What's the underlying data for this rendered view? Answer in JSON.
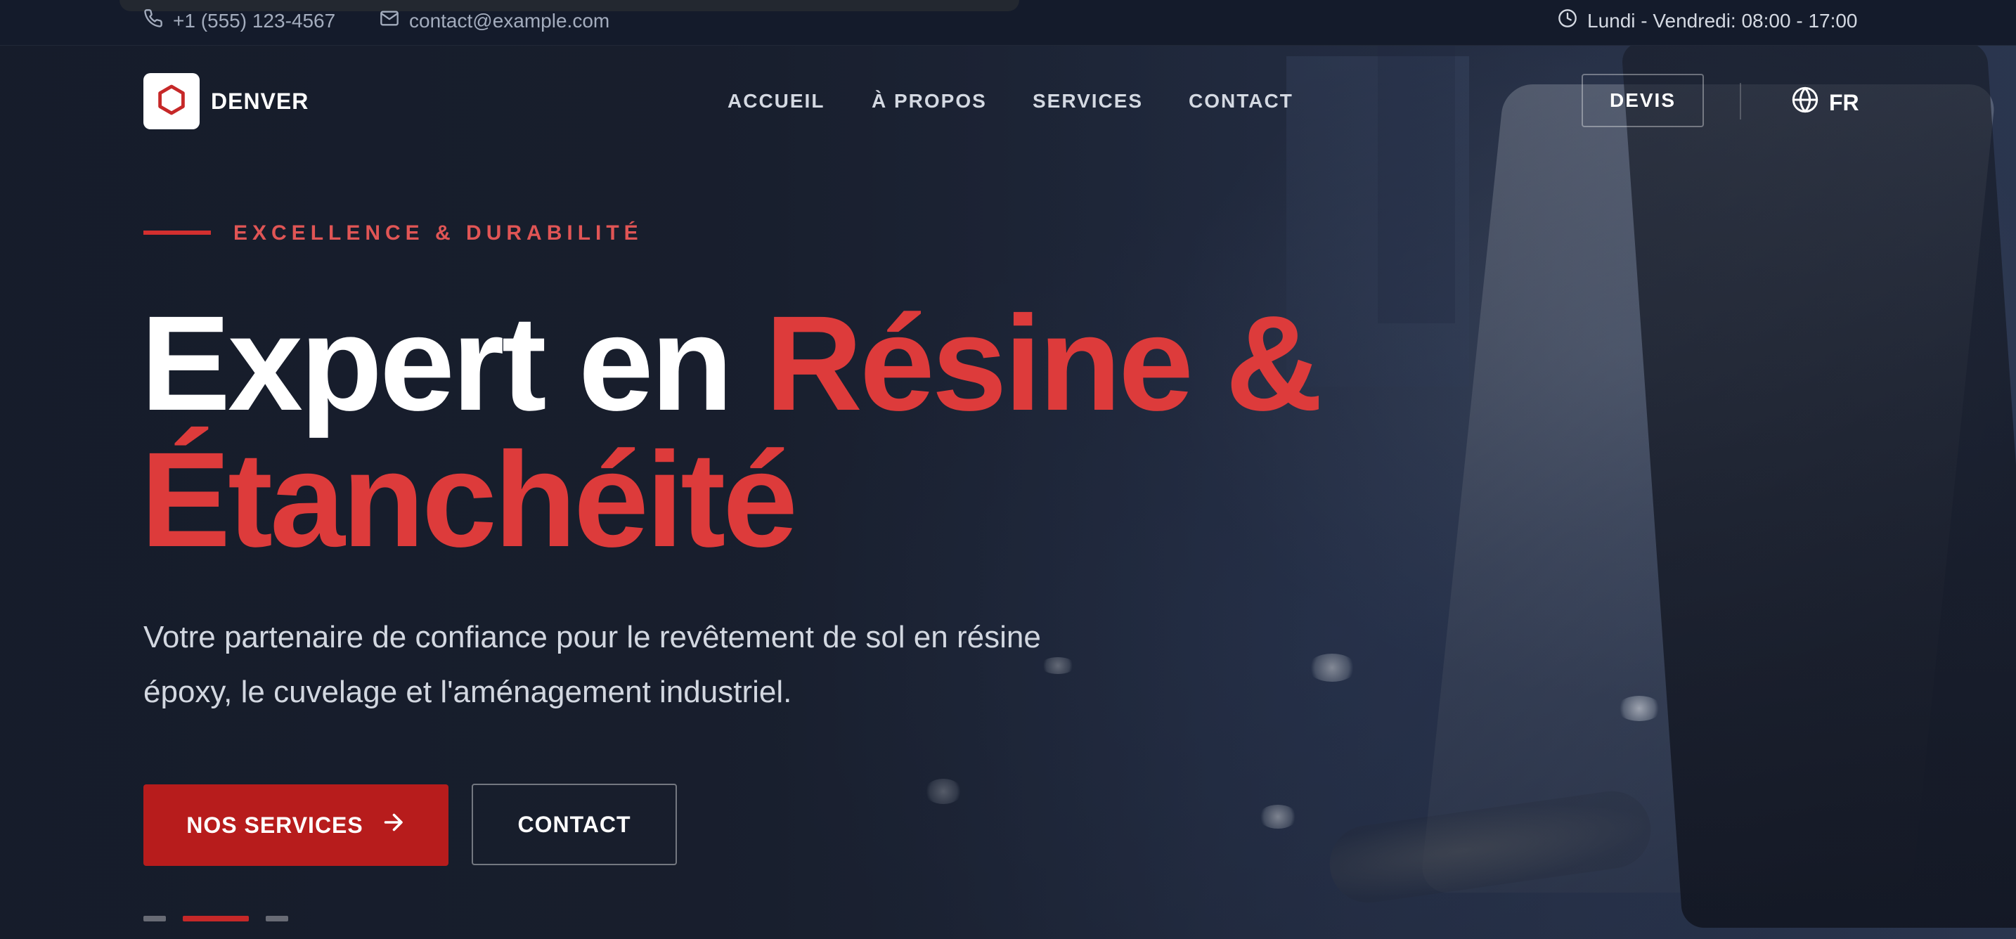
{
  "topbar": {
    "phone": "+1 (555) 123-4567",
    "email": "contact@example.com",
    "hours": "Lundi - Vendredi: 08:00 - 17:00"
  },
  "nav": {
    "brand": "DENVER",
    "links": [
      "ACCUEIL",
      "À PROPOS",
      "SERVICES",
      "CONTACT"
    ],
    "cta": "DEVIS",
    "language": "FR"
  },
  "hero": {
    "eyebrow": "EXCELLENCE & DURABILITÉ",
    "headline_white": "Expert en ",
    "headline_accent_1": "Résine &",
    "headline_accent_2": "Étanchéité",
    "subtitle": "Votre partenaire de confiance pour le revêtement de sol en résine époxy, le cuvelage et l'aménagement industriel.",
    "primary_button": "NOS SERVICES",
    "secondary_button": "CONTACT",
    "slides": {
      "count": 3,
      "active_index": 1
    }
  },
  "icons": {
    "phone": "phone-icon",
    "email": "mail-icon",
    "hours": "clock-icon",
    "logo": "hexagon-logo-icon",
    "language": "globe-icon",
    "button_arrow": "arrow-right-icon"
  },
  "colors": {
    "accent": "#dd3b3b",
    "button_red": "#b71c1c",
    "eyebrow": "#e05555",
    "background": "#141c2b"
  }
}
